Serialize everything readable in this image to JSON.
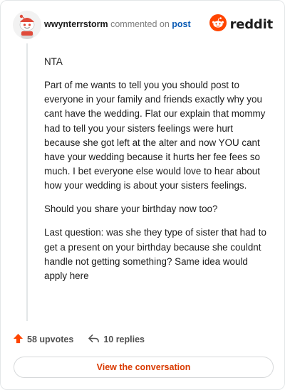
{
  "header": {
    "username": "wwynterrstorm",
    "verb": "commented on",
    "post_link": "post",
    "brand_name": "reddit"
  },
  "comment": {
    "paragraphs": [
      "NTA",
      "Part of me wants to tell you you should post to everyone in your family and friends exactly why you cant have the wedding. Flat our explain that mommy had to tell you your sisters feelings were hurt because she got left at the alter and now YOU cant have your wedding because it hurts her fee fees so much. I bet everyone else would love to hear about how your wedding is about your sisters feelings.",
      "Should you share your birthday now too?",
      "Last question: was she they type of sister that had to get a present on your birthday because she couldnt handle not getting something? Same idea would apply here"
    ]
  },
  "footer": {
    "upvotes": "58 upvotes",
    "replies": "10 replies",
    "cta_label": "View the conversation"
  },
  "colors": {
    "brand_orange": "#ff4500",
    "link_blue": "#0a5bb5",
    "cta_text": "#d93a00",
    "upvote_orange": "#ff4500"
  },
  "icons": {
    "avatar": "snoo-avatar-icon",
    "brand": "reddit-logo-icon",
    "upvote": "upvote-arrow-icon",
    "replies": "reply-arrow-icon"
  }
}
